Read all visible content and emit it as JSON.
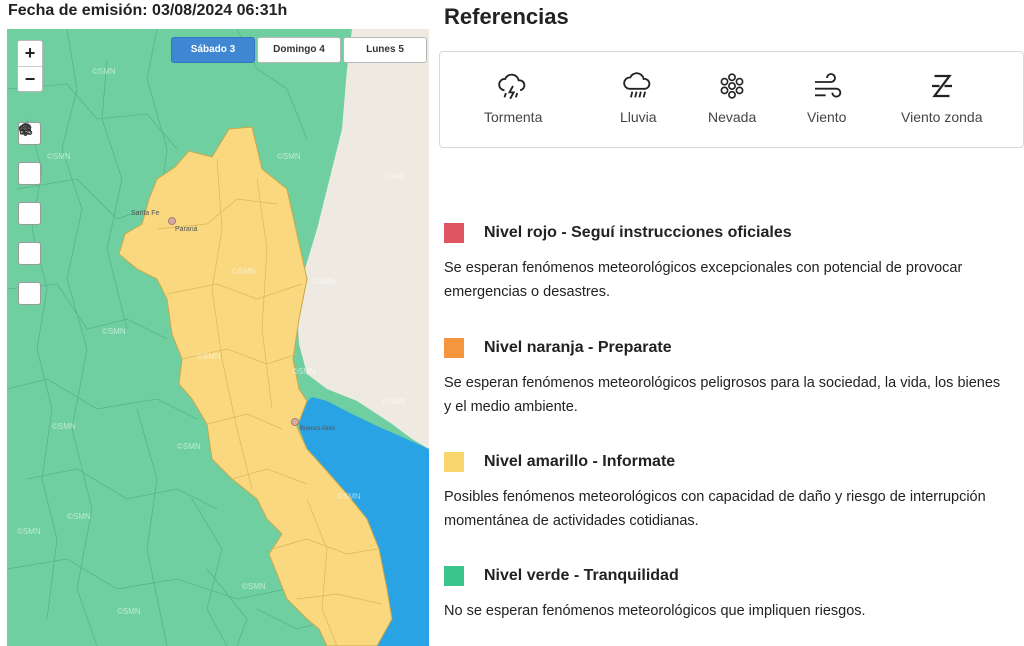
{
  "issue": {
    "text": "Fecha de emisión: 03/08/2024 06:31h"
  },
  "map": {
    "zoom_in": "+",
    "zoom_out": "−",
    "tabs": [
      {
        "label": "Sábado 3",
        "active": true
      },
      {
        "label": "Domingo 4",
        "active": false
      },
      {
        "label": "Lunes 5",
        "active": false
      }
    ],
    "tools": [
      "storm-icon",
      "rain-icon",
      "snow-icon",
      "wind-icon",
      "zonda-wind-icon"
    ],
    "place_labels": [
      "Santa Fe",
      "Paraná",
      "Buenos Aires"
    ],
    "watermark": "©SMN"
  },
  "references": {
    "title": "Referencias",
    "legend": [
      {
        "icon": "storm-icon",
        "label": "Tormenta"
      },
      {
        "icon": "rain-icon",
        "label": "Lluvia"
      },
      {
        "icon": "snow-icon",
        "label": "Nevada"
      },
      {
        "icon": "wind-icon",
        "label": "Viento"
      },
      {
        "icon": "zonda-wind-icon",
        "label": "Viento zonda"
      }
    ],
    "levels": [
      {
        "color": "#e05562",
        "name": "Nivel rojo - Seguí instrucciones oficiales",
        "description": "Se esperan fenómenos meteorológicos excepcionales con potencial de provocar emergencias o desastres."
      },
      {
        "color": "#f5963f",
        "name": "Nivel naranja - Preparate",
        "description": "Se esperan fenómenos meteorológicos peligrosos para la sociedad, la vida, los bienes y el medio ambiente."
      },
      {
        "color": "#f9d56e",
        "name": "Nivel amarillo - Informate",
        "description": "Posibles fenómenos meteorológicos con capacidad de daño y riesgo de interrupción momentánea de actividades cotidianas."
      },
      {
        "color": "#3cc48d",
        "name": "Nivel verde - Tranquilidad",
        "description": "No se esperan fenómenos meteorológicos que impliquen riesgos."
      }
    ]
  },
  "colors": {
    "green_zone": "#6fcfa0",
    "yellow_zone": "#f9d880",
    "water": "#29a3e3",
    "land_neutral": "#eeeae2",
    "active_tab": "#3f86d3"
  }
}
